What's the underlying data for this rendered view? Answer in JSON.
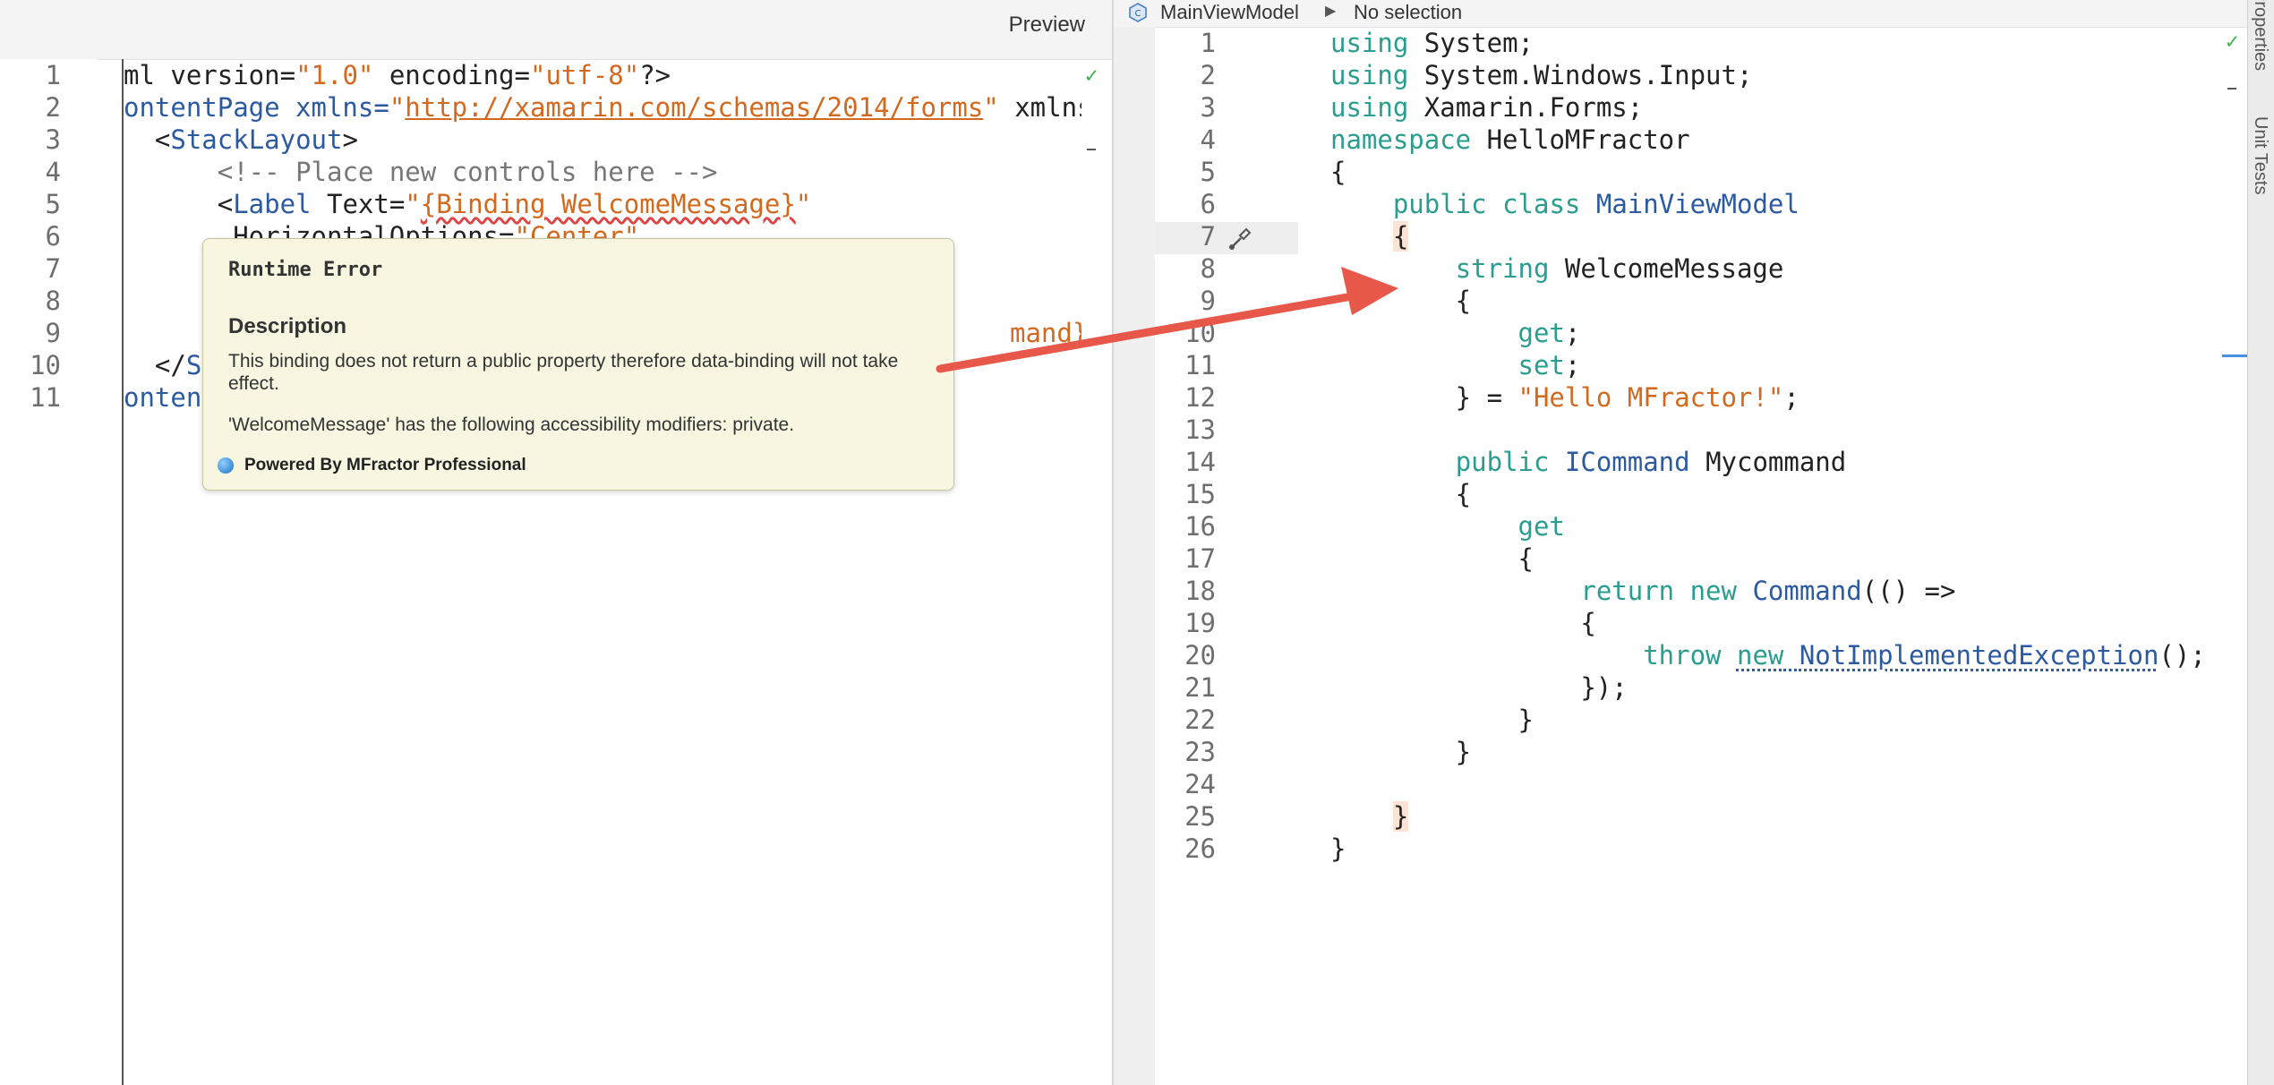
{
  "left_editor": {
    "preview_label": "Preview",
    "line_numbers": [
      "1",
      "2",
      "3",
      "4",
      "5",
      "6",
      "7",
      "8",
      "9",
      "10",
      "11"
    ],
    "lines": {
      "l1": [
        "ml version=",
        "\"1.0\"",
        " encoding=",
        "\"utf-8\"",
        "?>"
      ],
      "l2": [
        "ontentPage xmlns=",
        "\"",
        "http://xamarin.com/schemas/2014/forms",
        "\"",
        " xmlns"
      ],
      "l3": [
        "  <",
        "StackLayout",
        ">"
      ],
      "l4": [
        "      ",
        "<!-- Place new controls here -->"
      ],
      "l5": [
        "      <",
        "Label",
        " Text=",
        "\"",
        "{Binding WelcomeMessage}",
        "\""
      ],
      "l6": [
        "       HorizontalOptions=",
        "\"",
        "Center",
        "\""
      ],
      "l9": [
        "mand}\"",
        "/>"
      ],
      "l10": [
        "  </",
        "St"
      ],
      "l11": [
        "ontent"
      ]
    }
  },
  "tooltip": {
    "title": "Runtime Error",
    "description_heading": "Description",
    "description": "This binding does not return a public property therefore data-binding will not take effect.",
    "detail": "'WelcomeMessage' has the following accessibility modifiers: private.",
    "footer": "Powered By MFractor Professional"
  },
  "right_editor": {
    "breadcrumb": {
      "class_name": "MainViewModel",
      "separator": "▶",
      "selection": "No selection"
    },
    "line_numbers": [
      "1",
      "2",
      "3",
      "4",
      "5",
      "6",
      "7",
      "8",
      "9",
      "10",
      "11",
      "12",
      "13",
      "14",
      "15",
      "16",
      "17",
      "18",
      "19",
      "20",
      "21",
      "22",
      "23",
      "24",
      "25",
      "26"
    ],
    "lines": {
      "r1": [
        "using",
        " System;"
      ],
      "r2": [
        "using",
        " System.Windows.Input;"
      ],
      "r3": [
        "using",
        " Xamarin.Forms;"
      ],
      "r4": [
        "namespace",
        " HelloMFractor"
      ],
      "r5": [
        "{"
      ],
      "r6": [
        "    ",
        "public",
        " ",
        "class",
        " ",
        "MainViewModel"
      ],
      "r7": [
        "    ",
        "{"
      ],
      "r8": [
        "        ",
        "string",
        " WelcomeMessage"
      ],
      "r9": [
        "        {"
      ],
      "r10": [
        "            ",
        "get",
        ";"
      ],
      "r11": [
        "            ",
        "set",
        ";"
      ],
      "r12": [
        "        } = ",
        "\"Hello MFractor!\"",
        ";"
      ],
      "r14": [
        "        ",
        "public",
        " ",
        "ICommand",
        " Mycommand"
      ],
      "r15": [
        "        {"
      ],
      "r16": [
        "            ",
        "get"
      ],
      "r17": [
        "            {"
      ],
      "r18": [
        "                ",
        "return",
        " ",
        "new",
        " ",
        "Command",
        "(() =>"
      ],
      "r19": [
        "                {"
      ],
      "r20": [
        "                    ",
        "throw",
        " ",
        "new",
        " ",
        "NotImplementedException",
        "();"
      ],
      "r21": [
        "                });"
      ],
      "r22": [
        "            }"
      ],
      "r23": [
        "        }"
      ],
      "r25": [
        "    ",
        "}"
      ],
      "r26": [
        "}"
      ]
    }
  },
  "side_panel": {
    "properties_tab": "Properties",
    "unit_tests_tab": "Unit Tests"
  },
  "colors": {
    "keyword": "#2a9d8f",
    "type": "#2c5aa0",
    "string": "#d2691e",
    "arrow": "#e8584a",
    "tooltip_bg": "#f8f6e0"
  },
  "icons": [
    "class-icon",
    "paintbrush-icon",
    "checkmark-icon",
    "mfractor-logo"
  ]
}
